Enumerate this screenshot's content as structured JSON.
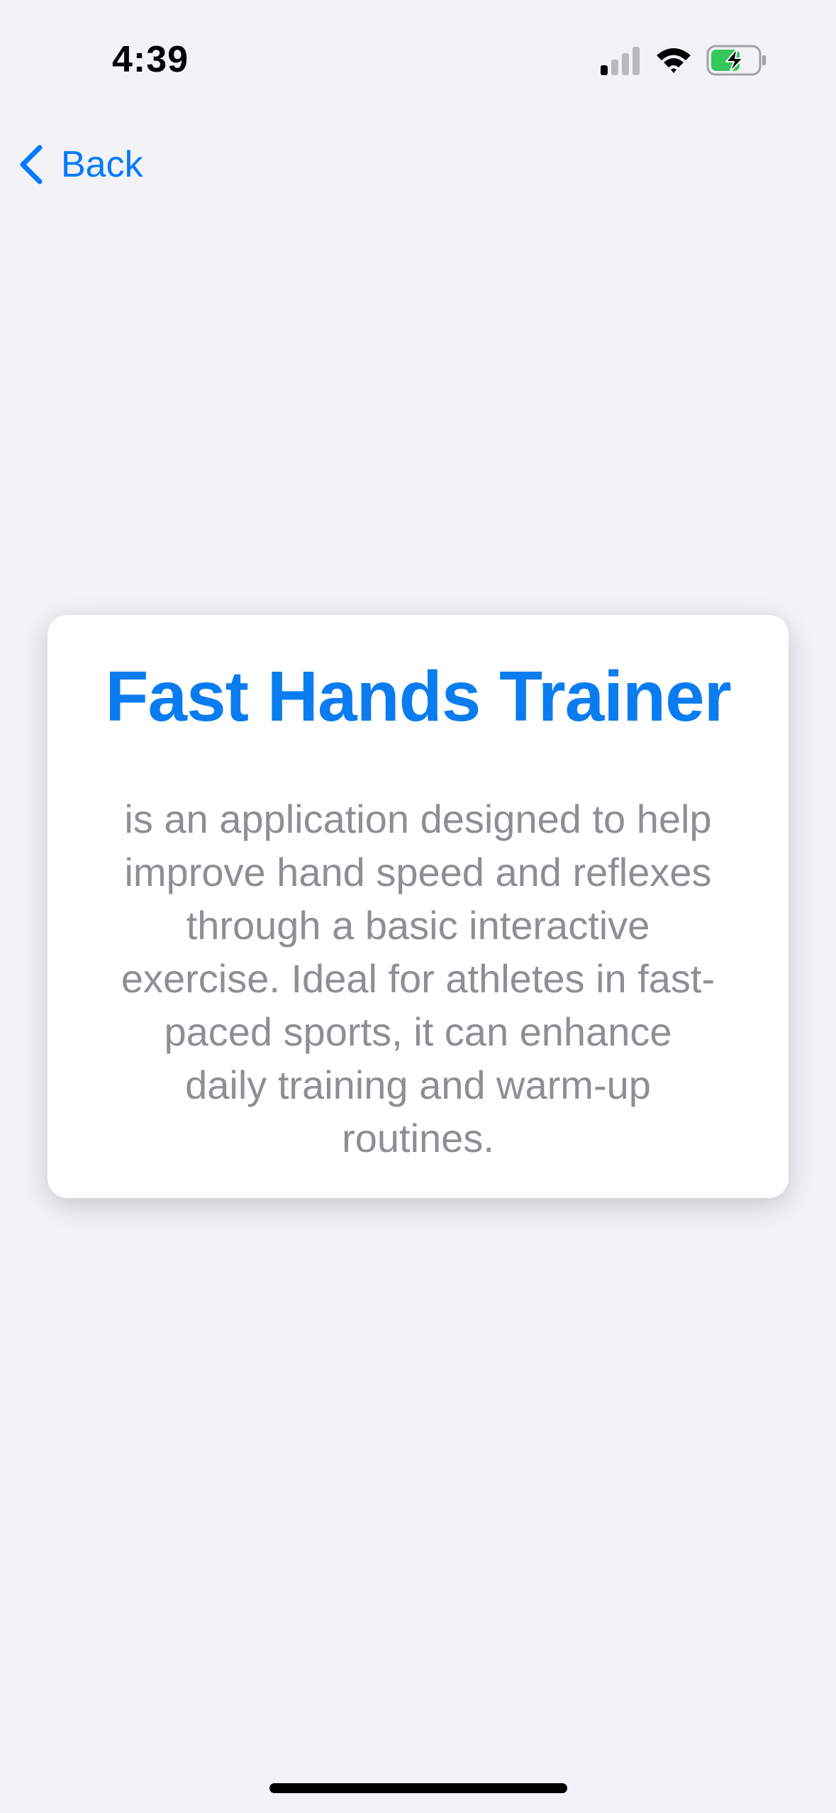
{
  "status_bar": {
    "time": "4:39"
  },
  "nav": {
    "back_label": "Back"
  },
  "card": {
    "title": "Fast Hands Trainer",
    "description": "is an application designed to help improve hand speed and reflexes through a basic interactive exercise. Ideal for athletes in fast-paced sports, it can enhance daily training and warm-up routines."
  },
  "colors": {
    "accent": "#007aff",
    "title": "#0a7cf0",
    "body_text": "#8e8e93",
    "background": "#f2f2f7",
    "battery_fill": "#34c759"
  },
  "icons": {
    "signal": "cellular-signal-icon",
    "wifi": "wifi-icon",
    "battery": "battery-charging-icon",
    "back": "chevron-left-icon"
  }
}
